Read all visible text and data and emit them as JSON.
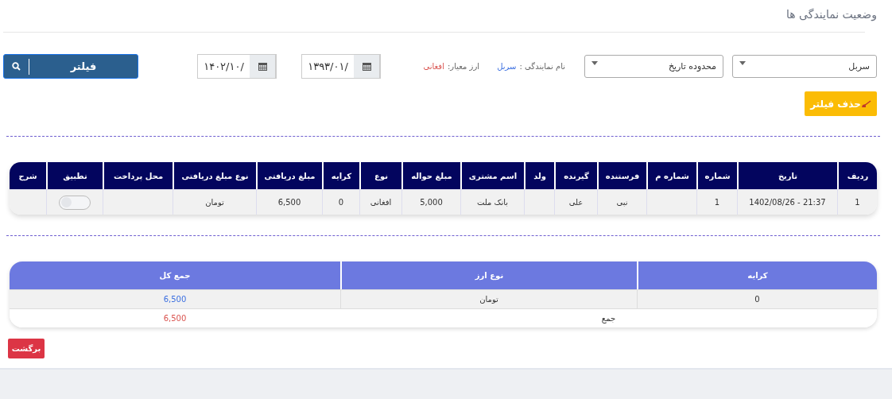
{
  "page": {
    "title": "وضعیت نمایندگی ها"
  },
  "filters": {
    "agency_select": "سربل",
    "range_select": "محدوده تاریخ",
    "agency_label": "نام نمایندگی :",
    "agency_value": "سربل",
    "currency_label": "ارز معیار:",
    "currency_value": "افغانی",
    "from_date": "۱۳۹۳/۰۱/",
    "to_date": "۱۴۰۲/۱۰/",
    "filter_button": "فیلتر",
    "clear_button": "حذف فیلتر"
  },
  "table": {
    "columns": [
      "ردیف",
      "تاریخ",
      "شماره",
      "شماره م",
      "فرستنده",
      "گیرنده",
      "ولد",
      "اسم مشتری",
      "مبلغ حواله",
      "نوع",
      "کرایه",
      "مبلغ دریافتی",
      "نوع مبلغ دریافتی",
      "محل پرداخت",
      "تطبیق",
      "شرح"
    ],
    "rows": [
      {
        "cells": [
          "1",
          "1402/08/26 - 21:37",
          "1",
          "",
          "نبی",
          "علی",
          "",
          "بانک ملت",
          "5,000",
          "افغانی",
          "0",
          "6,500",
          "تومان",
          ""
        ],
        "matched": false
      }
    ]
  },
  "summary": {
    "columns": [
      "کرایه",
      "نوع ارز",
      "جمع کل"
    ],
    "rows": [
      {
        "cells": [
          "0",
          "تومان",
          "6,500"
        ]
      }
    ],
    "total": {
      "label": "جمع",
      "value": "6,500"
    }
  },
  "back_button": "برگشت"
}
